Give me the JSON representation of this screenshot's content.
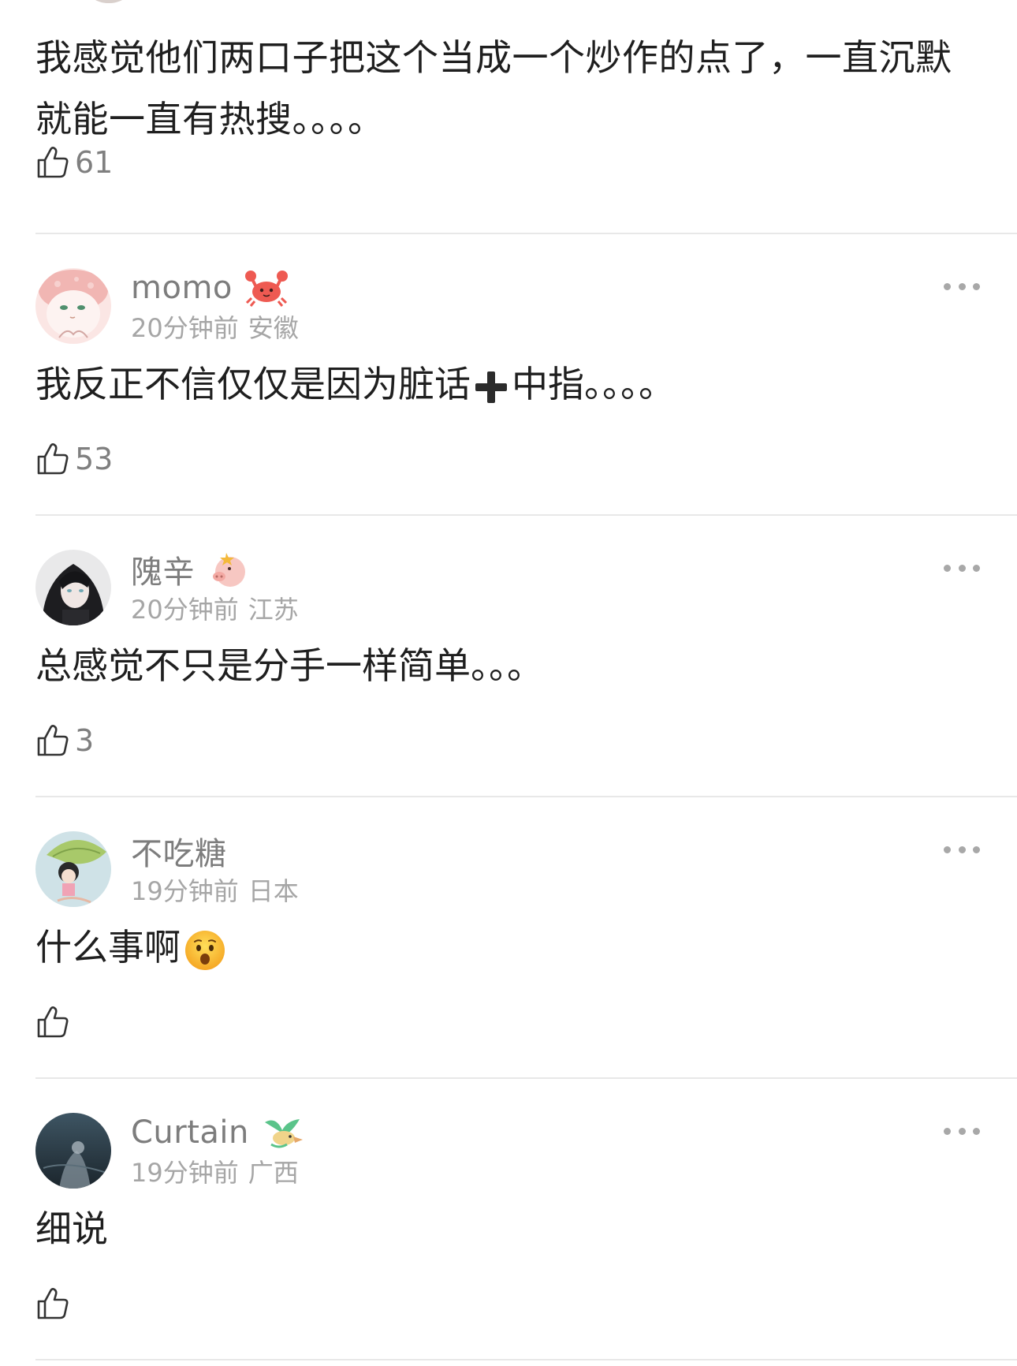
{
  "top_comment": {
    "text": "我感觉他们两口子把这个当成一个炒作的点了，一直沉默就能一直有热搜。。。。",
    "likes": "61"
  },
  "comments": [
    {
      "username": "momo",
      "badge_icon": "crab-badge-icon",
      "time": "20分钟前",
      "location": "安徽",
      "text_before": "我反正不信仅仅是因为脏话",
      "text_emoji": "heavy-plus-icon",
      "text_after": "中指。。。。",
      "likes": "53"
    },
    {
      "username": "隗辛",
      "badge_icon": "pig-badge-icon",
      "time": "20分钟前",
      "location": "江苏",
      "text": "总感觉不只是分手一样简单。。。",
      "likes": "3"
    },
    {
      "username": "不吃糖",
      "time": "19分钟前",
      "location": "日本",
      "text": "什么事啊",
      "text_emoji": "surprised-face-icon",
      "likes": ""
    },
    {
      "username": "Curtain",
      "badge_icon": "bird-badge-icon",
      "time": "19分钟前",
      "location": "广西",
      "text": "细说",
      "likes": ""
    }
  ],
  "colors": {
    "text": "#1f1f1f",
    "username": "#7d7d7d",
    "meta": "#a6a6a6",
    "divider": "#e8e8e8"
  }
}
